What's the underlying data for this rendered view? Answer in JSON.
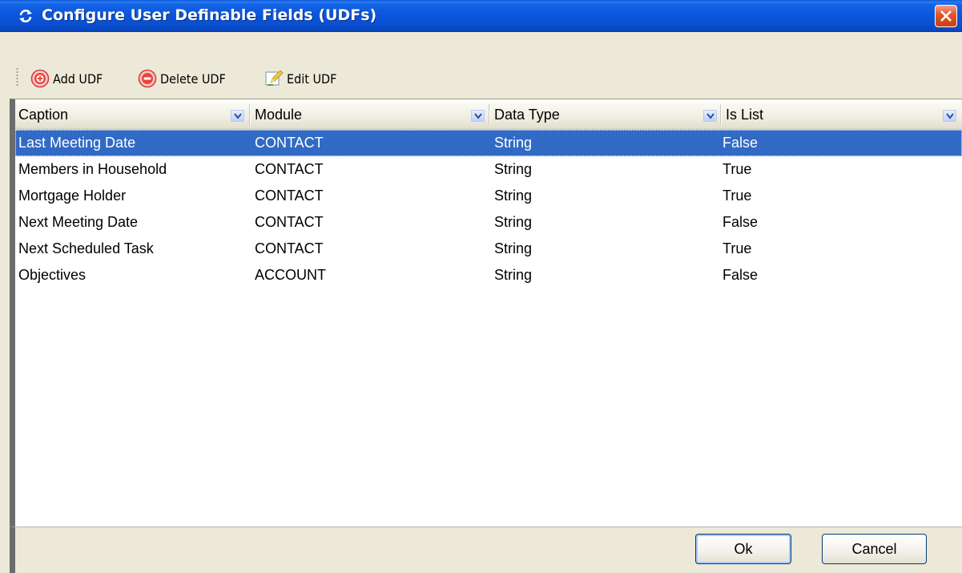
{
  "window": {
    "title": "Configure User Definable Fields (UDFs)",
    "icons": {
      "app": "refresh-icon",
      "close": "close-icon"
    }
  },
  "toolbar": {
    "add_label": "Add UDF",
    "delete_label": "Delete UDF",
    "edit_label": "Edit UDF",
    "icons": {
      "add": "add-circle-icon",
      "delete": "delete-circle-icon",
      "edit": "edit-pencil-icon"
    }
  },
  "grid": {
    "columns": [
      {
        "label": "Caption"
      },
      {
        "label": "Module"
      },
      {
        "label": "Data Type"
      },
      {
        "label": "Is List"
      }
    ],
    "rows": [
      {
        "caption": "Last Meeting Date",
        "module": "CONTACT",
        "data_type": "String",
        "is_list": "False",
        "selected": true
      },
      {
        "caption": "Members in Household",
        "module": "CONTACT",
        "data_type": "String",
        "is_list": "True",
        "selected": false
      },
      {
        "caption": "Mortgage Holder",
        "module": "CONTACT",
        "data_type": "String",
        "is_list": "True",
        "selected": false
      },
      {
        "caption": "Next Meeting Date",
        "module": "CONTACT",
        "data_type": "String",
        "is_list": "False",
        "selected": false
      },
      {
        "caption": "Next Scheduled Task",
        "module": "CONTACT",
        "data_type": "String",
        "is_list": "True",
        "selected": false
      },
      {
        "caption": "Objectives",
        "module": "ACCOUNT",
        "data_type": "String",
        "is_list": "False",
        "selected": false
      }
    ]
  },
  "footer": {
    "ok_label": "Ok",
    "cancel_label": "Cancel"
  },
  "colors": {
    "titlebar": "#0b55da",
    "selection": "#316ac5",
    "dialog_bg": "#ece9d8"
  }
}
